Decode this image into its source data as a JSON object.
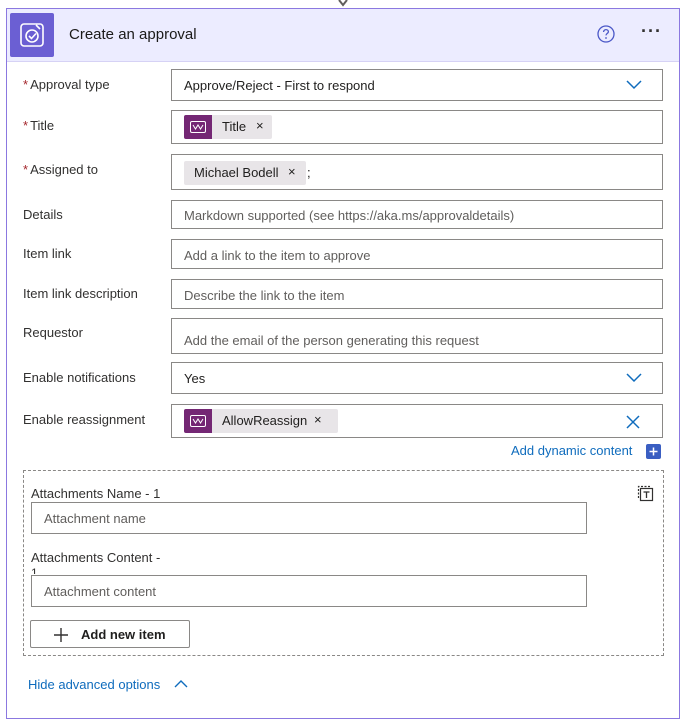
{
  "header": {
    "title": "Create an approval",
    "icons": {
      "app": "approval-icon",
      "help": "help-icon",
      "more": "more-options-icon"
    }
  },
  "fields": {
    "approval_type": {
      "label": "Approval type",
      "required": "*",
      "value": "Approve/Reject - First to respond"
    },
    "title": {
      "label": "Title",
      "required": "*",
      "token": "Title",
      "token_remove": "×"
    },
    "assigned_to": {
      "label": "Assigned to",
      "required": "*",
      "token": "Michael Bodell",
      "token_remove": "×",
      "separator": ";"
    },
    "details": {
      "label": "Details",
      "placeholder": "Markdown supported (see https://aka.ms/approvaldetails)"
    },
    "item_link": {
      "label": "Item link",
      "placeholder": "Add a link to the item to approve"
    },
    "item_link_description": {
      "label": "Item link description",
      "placeholder": "Describe the link to the item"
    },
    "requestor": {
      "label": "Requestor",
      "placeholder": "Add the email of the person generating this request"
    },
    "enable_notifications": {
      "label": "Enable notifications",
      "value": "Yes"
    },
    "enable_reassignment": {
      "label": "Enable reassignment",
      "token": "AllowReassign",
      "token_remove": "×"
    }
  },
  "dynamic_content": {
    "label": "Add dynamic content"
  },
  "attachments": {
    "name_label": "Attachments Name - 1",
    "name_placeholder": "Attachment name",
    "content_label_line1": "Attachments Content -",
    "content_label_line2": "1",
    "content_placeholder": "Attachment content",
    "add_label": "Add new item"
  },
  "footer": {
    "hide_advanced": "Hide advanced options"
  },
  "colors": {
    "header_bg": "#ececff",
    "accent_purple": "#6b5fd3",
    "token_icon": "#742774",
    "link_blue": "#0f6cbd",
    "required_red": "#a4262c"
  }
}
